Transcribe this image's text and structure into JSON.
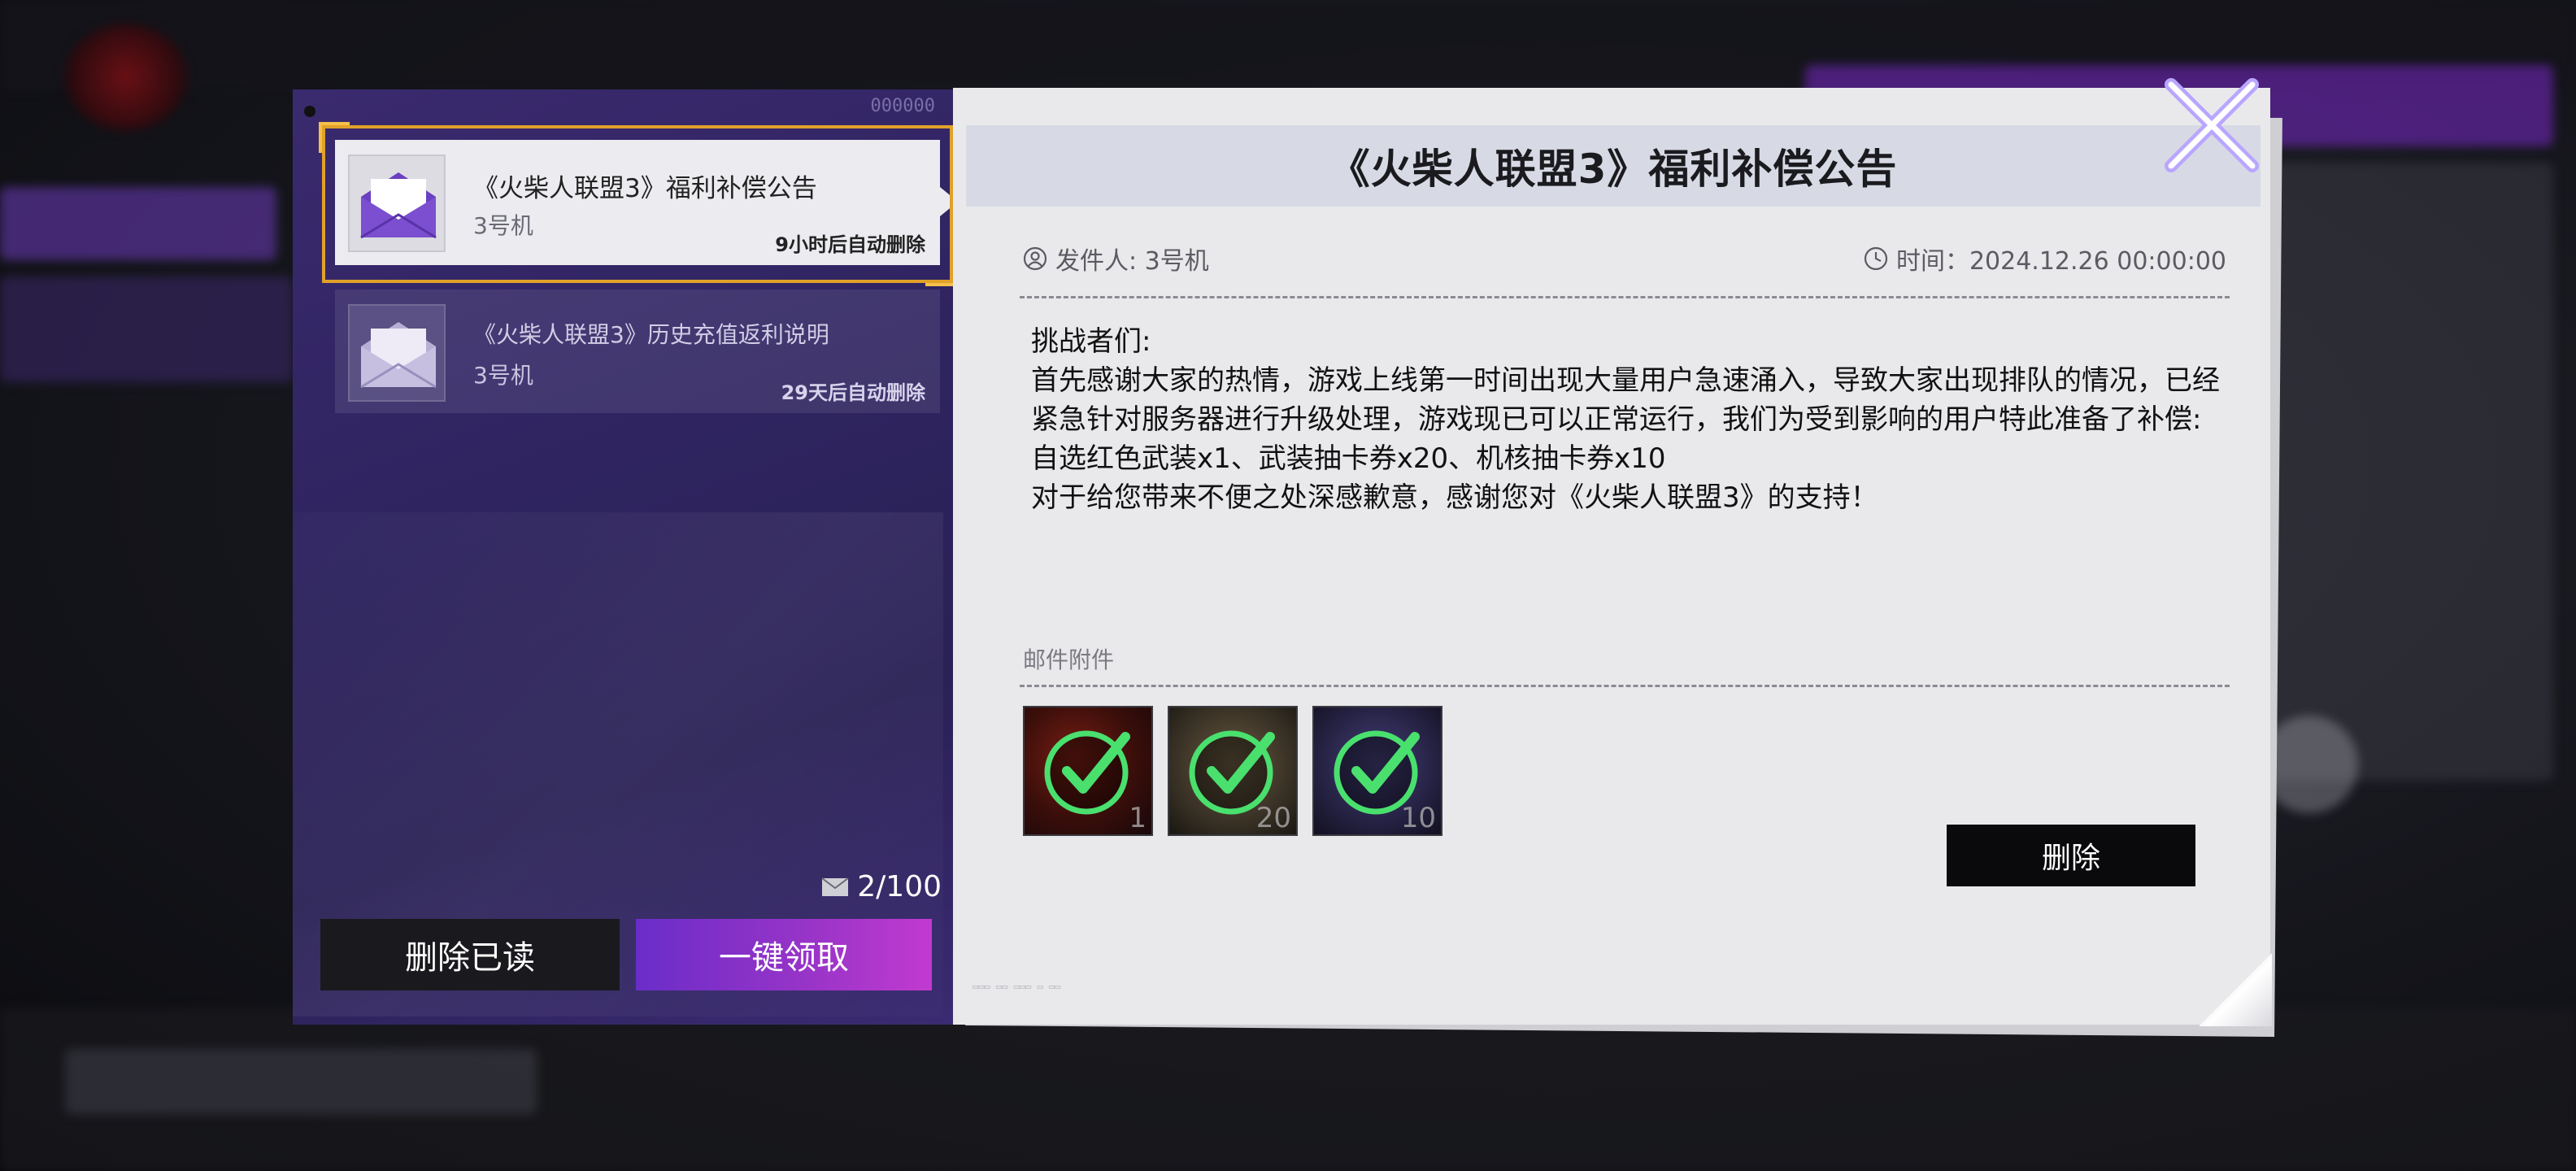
{
  "left_panel": {
    "panel_id": "000000",
    "mails": [
      {
        "title": "《火柴人联盟3》福利补偿公告",
        "sender": "3号机",
        "expire": "9小时后自动删除",
        "selected": true
      },
      {
        "title": "《火柴人联盟3》历史充值返利说明",
        "sender": "3号机",
        "expire": "29天后自动删除",
        "selected": false
      }
    ],
    "mail_count": "2/100",
    "delete_read_label": "删除已读",
    "claim_all_label": "一键领取"
  },
  "mail_detail": {
    "title": "《火柴人联盟3》福利补偿公告",
    "sender_label": "发件人: 3号机",
    "time_label": "时间：2024.12.26 00:00:00",
    "body": [
      "挑战者们:",
      "首先感谢大家的热情，游戏上线第一时间出现大量用户急速涌入，导致大家出现排队的情况，已经紧急针对服务器进行升级处理，游戏现已可以正常运行，我们为受到影响的用户特此准备了补偿:",
      "自选红色武装x1、武装抽卡券x20、机核抽卡券x10",
      "对于给您带来不便之处深感歉意，感谢您对《火柴人联盟3》的支持！"
    ],
    "attachments_label": "邮件附件",
    "attachments": [
      {
        "icon": "red-armament-icon",
        "qty": "1",
        "claimed": true
      },
      {
        "icon": "armament-card-ticket-icon",
        "qty": "20",
        "claimed": true
      },
      {
        "icon": "core-card-ticket-icon",
        "qty": "10",
        "claimed": true
      }
    ],
    "delete_label": "删除"
  },
  "colors": {
    "panel_purple": "#2f2460",
    "highlight_gold": "#e0a12a",
    "claim_gradient_start": "#6a2dc8",
    "claim_gradient_end": "#c23ad0",
    "check_green": "#49e06e",
    "close_x": "#d8d0ff"
  }
}
